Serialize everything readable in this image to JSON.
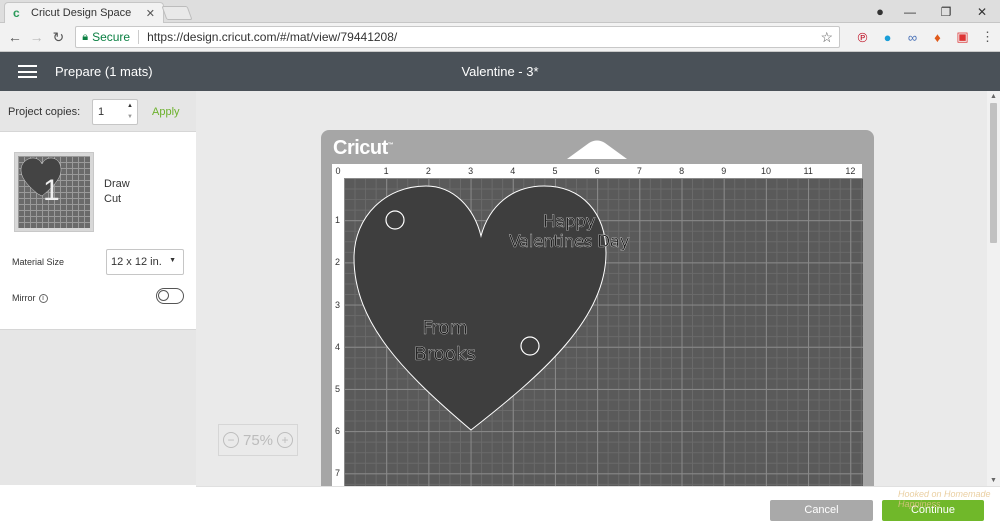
{
  "browser": {
    "tab_title": "Cricut Design Space",
    "tab_close": "✕",
    "secure_label": "Secure",
    "url": "https://design.cricut.com/#/mat/view/79441208/",
    "window_controls": {
      "minimize": "—",
      "restore": "❐",
      "close": "✕"
    }
  },
  "header": {
    "prepare_title": "Prepare (1 mats)",
    "project_title": "Valentine - 3*"
  },
  "sidebar": {
    "copies_label": "Project copies:",
    "copies_value": "1",
    "apply_label": "Apply",
    "mat_number": "1",
    "draw_label": "Draw",
    "cut_label": "Cut",
    "material_label": "Material Size",
    "material_value": "12 x 12 in.",
    "mirror_label": "Mirror",
    "info_glyph": "i"
  },
  "mat": {
    "logo": "Cricut",
    "x_ruler": [
      "0",
      "1",
      "2",
      "3",
      "4",
      "5",
      "6",
      "7",
      "8",
      "9",
      "10",
      "11",
      "12"
    ],
    "y_ruler": [
      "1",
      "2",
      "3",
      "4",
      "5",
      "6",
      "7"
    ],
    "design_text_1": [
      "Happy",
      "Valentines Day"
    ],
    "design_text_2": [
      "From",
      "Brooks"
    ]
  },
  "zoom": {
    "minus": "−",
    "value": "75%",
    "plus": "+"
  },
  "footer": {
    "cancel_label": "Cancel",
    "continue_label": "Continue",
    "watermark": "Hooked on Homemade Happiness"
  },
  "colors": {
    "header_bg": "#4a5158",
    "accent_green": "#70b82a",
    "mat_grid": "#5a5a5a",
    "heart_fill": "#3e3e3e"
  }
}
